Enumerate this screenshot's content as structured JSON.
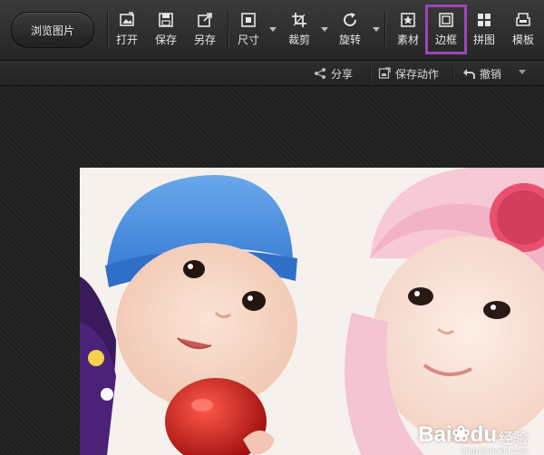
{
  "toolbar": {
    "browse_label": "浏览图片",
    "tools": [
      {
        "label": "打开",
        "icon": "open-image-icon"
      },
      {
        "label": "保存",
        "icon": "save-icon"
      },
      {
        "label": "另存",
        "icon": "save-as-icon"
      },
      {
        "label": "尺寸",
        "icon": "resize-icon"
      },
      {
        "label": "裁剪",
        "icon": "crop-icon"
      },
      {
        "label": "旋转",
        "icon": "rotate-icon"
      },
      {
        "label": "素材",
        "icon": "sticker-icon"
      },
      {
        "label": "边框",
        "icon": "border-frame-icon"
      },
      {
        "label": "拼图",
        "icon": "collage-icon"
      },
      {
        "label": "模板",
        "icon": "template-icon"
      }
    ]
  },
  "subbar": {
    "share_label": "分享",
    "save_action_label": "保存动作",
    "undo_label": "撤销"
  },
  "watermark": {
    "brand": "Bai",
    "brand_suffix": "du",
    "text": "经验",
    "url": "jingyan.baidu.com"
  },
  "colors": {
    "highlight": "#9b45b9",
    "toolbar_bg": "#2f2f2f"
  }
}
